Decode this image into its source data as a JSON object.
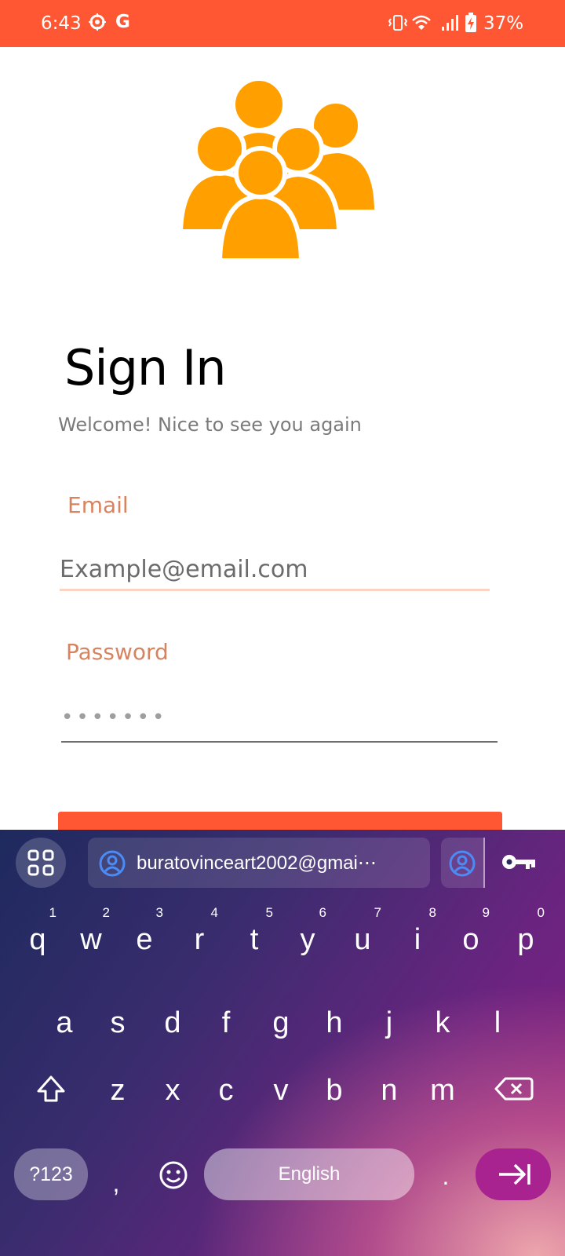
{
  "status_bar": {
    "time": "6:43",
    "carrier_logo": "G",
    "battery": "37%"
  },
  "signin": {
    "title": "Sign In",
    "subtitle": "Welcome! Nice to see you again",
    "email_label": "Email",
    "email_placeholder": "Example@email.com",
    "password_label": "Password",
    "password_value": "•••••••"
  },
  "colors": {
    "accent": "#FF5733",
    "label": "#D9835E",
    "logo": "#FFA000"
  },
  "keyboard": {
    "suggestion": "buratovinceart2002@gmai⋯",
    "row1": [
      {
        "k": "q",
        "h": "1"
      },
      {
        "k": "w",
        "h": "2"
      },
      {
        "k": "e",
        "h": "3"
      },
      {
        "k": "r",
        "h": "4"
      },
      {
        "k": "t",
        "h": "5"
      },
      {
        "k": "y",
        "h": "6"
      },
      {
        "k": "u",
        "h": "7"
      },
      {
        "k": "i",
        "h": "8"
      },
      {
        "k": "o",
        "h": "9"
      },
      {
        "k": "p",
        "h": "0"
      }
    ],
    "row2": [
      "a",
      "s",
      "d",
      "f",
      "g",
      "h",
      "j",
      "k",
      "l"
    ],
    "row3": [
      "z",
      "x",
      "c",
      "v",
      "b",
      "n",
      "m"
    ],
    "symbols": "?123",
    "comma": ",",
    "space": "English",
    "period": "."
  }
}
